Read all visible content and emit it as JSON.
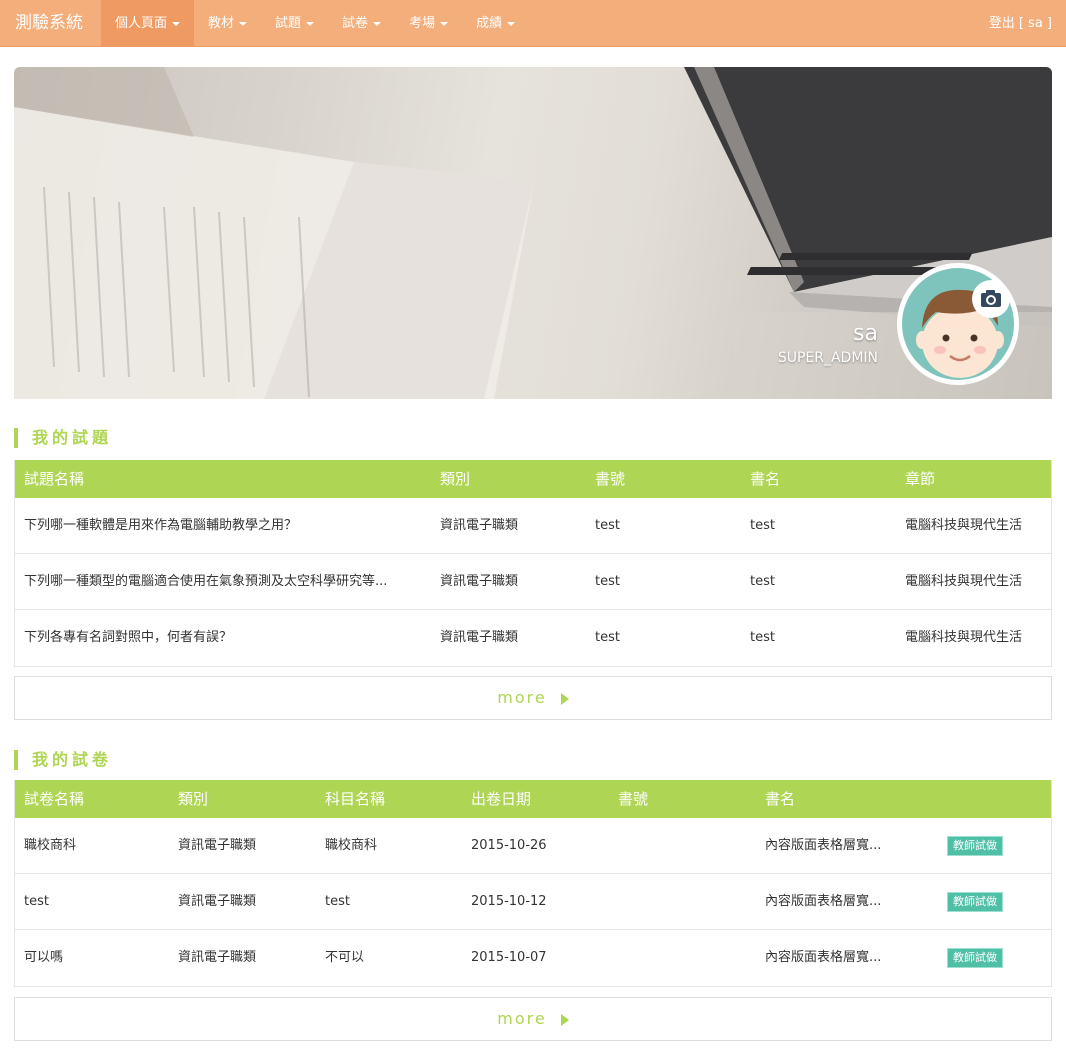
{
  "app": {
    "brand": "測驗系統",
    "logout": "登出 [ sa ]"
  },
  "nav": [
    {
      "label": "個人頁面",
      "active": true
    },
    {
      "label": "教材"
    },
    {
      "label": "試題"
    },
    {
      "label": "試卷"
    },
    {
      "label": "考場"
    },
    {
      "label": "成績"
    }
  ],
  "profile": {
    "name": "sa",
    "role": "SUPER_ADMIN"
  },
  "questions": {
    "title": "我的試題",
    "headers": [
      "試題名稱",
      "類別",
      "書號",
      "書名",
      "章節"
    ],
    "rows": [
      [
        "下列哪一種軟體是用來作為電腦輔助教學之用？",
        "資訊電子職類",
        "test",
        "test",
        "電腦科技與現代生活"
      ],
      [
        "下列哪一種類型的電腦適合使用在氣象預測及太空科學研究等...",
        "資訊電子職類",
        "test",
        "test",
        "電腦科技與現代生活"
      ],
      [
        "下列各專有名詞對照中，何者有誤？",
        "資訊電子職類",
        "test",
        "test",
        "電腦科技與現代生活"
      ]
    ],
    "more": "more"
  },
  "exams": {
    "title": "我的試卷",
    "headers": [
      "試卷名稱",
      "類別",
      "科目名稱",
      "出卷日期",
      "書號",
      "書名",
      ""
    ],
    "rows": [
      [
        "職校商科",
        "資訊電子職類",
        "職校商科",
        "2015-10-26",
        "",
        "內容版面表格層寬...",
        "教師試做"
      ],
      [
        "test",
        "資訊電子職類",
        "test",
        "2015-10-12",
        "",
        "內容版面表格層寬...",
        "教師試做"
      ],
      [
        "可以嗎",
        "資訊電子職類",
        "不可以",
        "2015-10-07",
        "",
        "內容版面表格層寬...",
        "教師試做"
      ]
    ],
    "more": "more"
  },
  "colors": {
    "navbar": "#f4ae7b",
    "accent": "#aed553",
    "badge": "#4fc0a6"
  },
  "icons": {
    "camera": "camera-icon",
    "more": "triangle-right-icon",
    "dropdown": "caret-down-icon"
  }
}
